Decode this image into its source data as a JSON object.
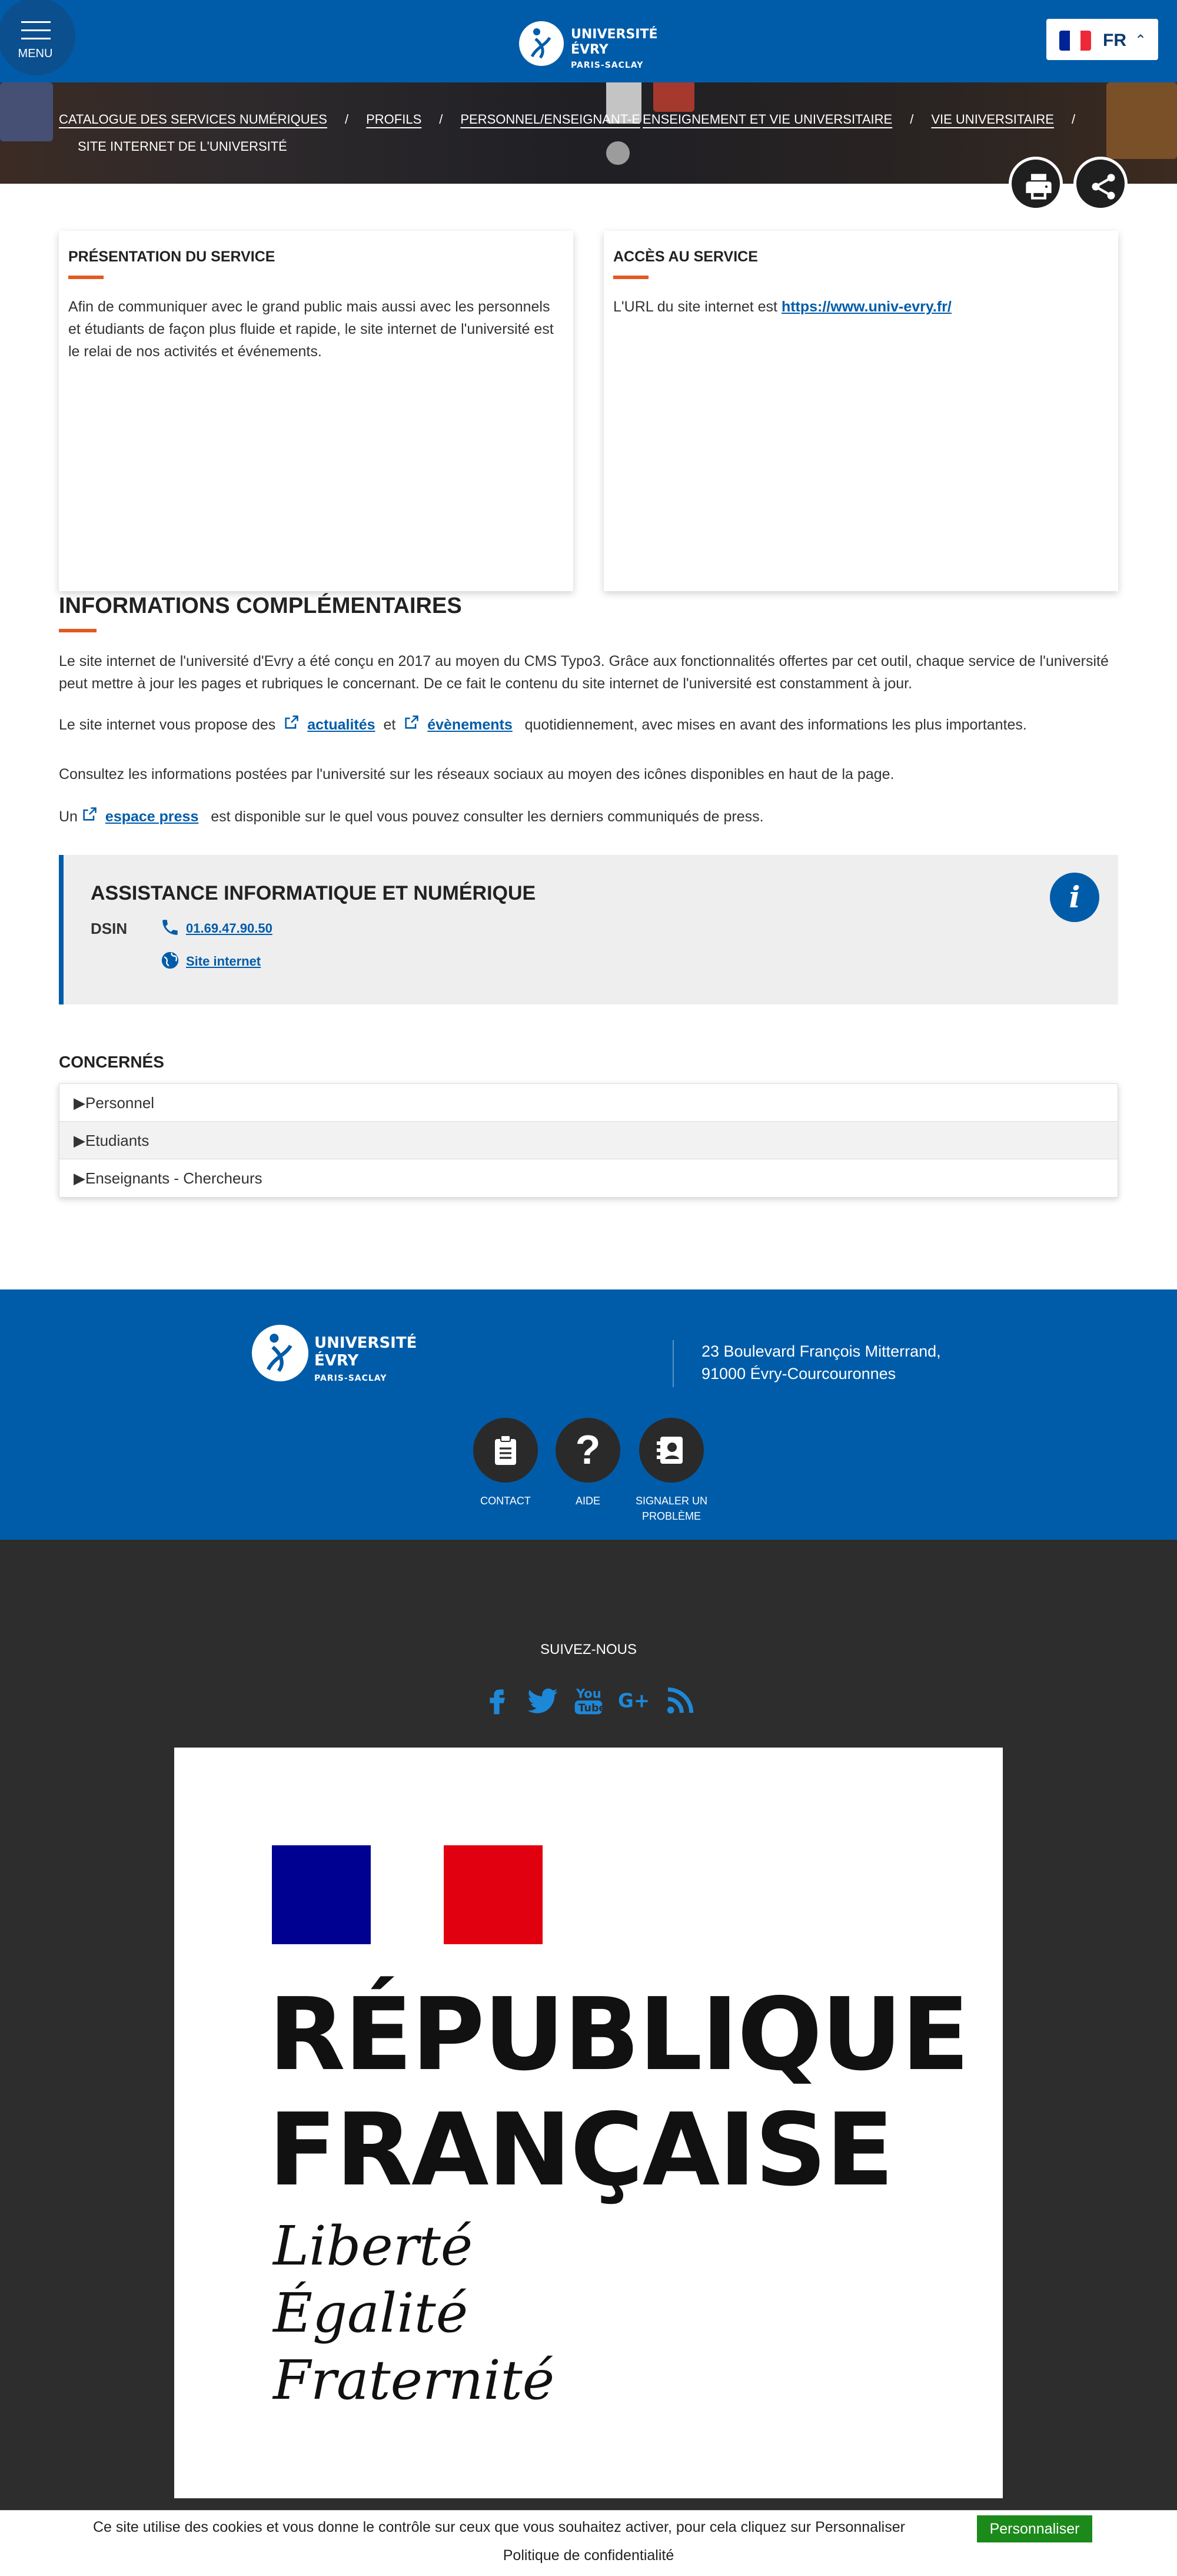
{
  "header": {
    "menu_label": "MENU",
    "logo_line1": "UNIVERSITÉ ÉVRY",
    "logo_line2": "PARIS-SACLAY",
    "language": "FR"
  },
  "breadcrumb": {
    "items": [
      "CATALOGUE DES SERVICES NUMÉRIQUES",
      "PROFILS",
      "PERSONNEL/ENSEIGNANT-E",
      "ENSEIGNEMENT ET VIE UNIVERSITAIRE",
      "VIE UNIVERSITAIRE"
    ],
    "current": "SITE INTERNET DE L'UNIVERSITÉ"
  },
  "presentation": {
    "title": "PRÉSENTATION DU SERVICE",
    "text": "Afin de communiquer avec le grand public mais aussi avec les personnels et étudiants de façon plus fluide et rapide, le site internet de l'université est le relai de nos activités et événements."
  },
  "access": {
    "title": "ACCÈS AU SERVICE",
    "text": "L'URL du site internet est ",
    "url": "https://www.univ-evry.fr/"
  },
  "info": {
    "title": "INFORMATIONS COMPLÉMENTAIRES",
    "p1": "Le site internet de l'université d'Evry a été conçu en 2017 au moyen du CMS Typo3. Grâce aux fonctionnalités offertes par cet outil, chaque service de l'université peut mettre à jour les pages et rubriques le concernant. De ce fait le contenu du site internet de l'université est constamment à jour.",
    "p2_before": "Le site internet vous propose des",
    "p2_link1": "actualités",
    "p2_mid": "et",
    "p2_link2": "évènements",
    "p2_after": "quotidiennement, avec mises en avant des informations les plus importantes.",
    "p3": "Consultez les informations postées par l'université sur les réseaux sociaux au moyen des icônes disponibles en haut de la page.",
    "p4_before": "Un",
    "p4_link": "espace press",
    "p4_after": "est disponible sur le quel vous pouvez consulter les derniers communiqués de press."
  },
  "assistance": {
    "title": "ASSISTANCE INFORMATIQUE ET NUMÉRIQUE",
    "dept": "DSIN",
    "phone": "01.69.47.90.50",
    "website": "Site internet",
    "badge": "i"
  },
  "concerned": {
    "title": "CONCERNÉS",
    "items": [
      "Personnel",
      "Etudiants",
      "Enseignants - Chercheurs"
    ]
  },
  "footer": {
    "logo_line1": "UNIVERSITÉ ÉVRY",
    "logo_line2": "PARIS-SACLAY",
    "address_line1": "23 Boulevard François Mitterrand,",
    "address_line2": "91000 Évry-Courcouronnes",
    "buttons": [
      {
        "label": "CONTACT",
        "icon": "clipboard-icon"
      },
      {
        "label": "AIDE",
        "icon": "question-icon"
      },
      {
        "label": "SIGNALER UN PROBLÈME",
        "icon": "report-icon"
      }
    ],
    "follow": "SUIVEZ-NOUS",
    "social": [
      "facebook-icon",
      "twitter-icon",
      "youtube-icon",
      "google-plus-icon",
      "rss-icon"
    ],
    "rf_title_line1": "RÉPUBLIQUE",
    "rf_title_line2": "FRANÇAISE",
    "rf_motto1": "Liberté",
    "rf_motto2": "Égalité",
    "rf_motto3": "Fraternité"
  },
  "cookie": {
    "text": "Ce site utilise des cookies et vous donne le contrôle sur ceux que vous souhaitez activer, pour cela cliquez sur Personnaliser",
    "button": "Personnaliser",
    "policy": "Politique de confidentialité"
  },
  "colors": {
    "primary": "#005ca9",
    "accent": "#e05a1f",
    "dark": "#2d2d2d",
    "cookie_button": "#1b8a1b"
  }
}
